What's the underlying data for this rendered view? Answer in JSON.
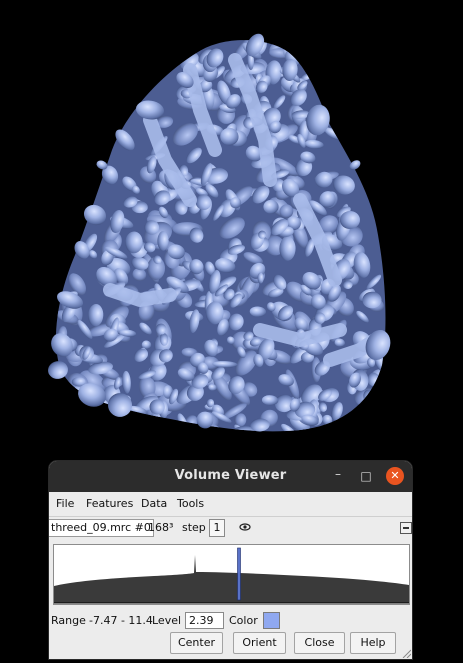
{
  "window": {
    "title": "Volume Viewer",
    "minimize_glyph": "–",
    "maximize_glyph": "□",
    "close_glyph": "✕"
  },
  "menu": {
    "items": [
      "File",
      "Features",
      "Data",
      "Tools"
    ]
  },
  "dataset": {
    "name": "threed_09.mrc #0",
    "size": "168³",
    "step_label": "step",
    "step_value": "1"
  },
  "histogram": {
    "level_marker_fraction": 0.52
  },
  "controls": {
    "range_label": "Range",
    "range_value": "-7.47 - 11.4",
    "level_label": "Level",
    "level_value": "2.39",
    "color_label": "Color",
    "surface_color": "#8fa8f0"
  },
  "buttons": {
    "center": "Center",
    "orient": "Orient",
    "close": "Close",
    "help": "Help"
  },
  "colors": {
    "background": "#000000",
    "surface": "#9fb4e6",
    "surface_shadow": "#3a4a78",
    "titlebar": "#2c2c2c",
    "close_button": "#e95420"
  }
}
